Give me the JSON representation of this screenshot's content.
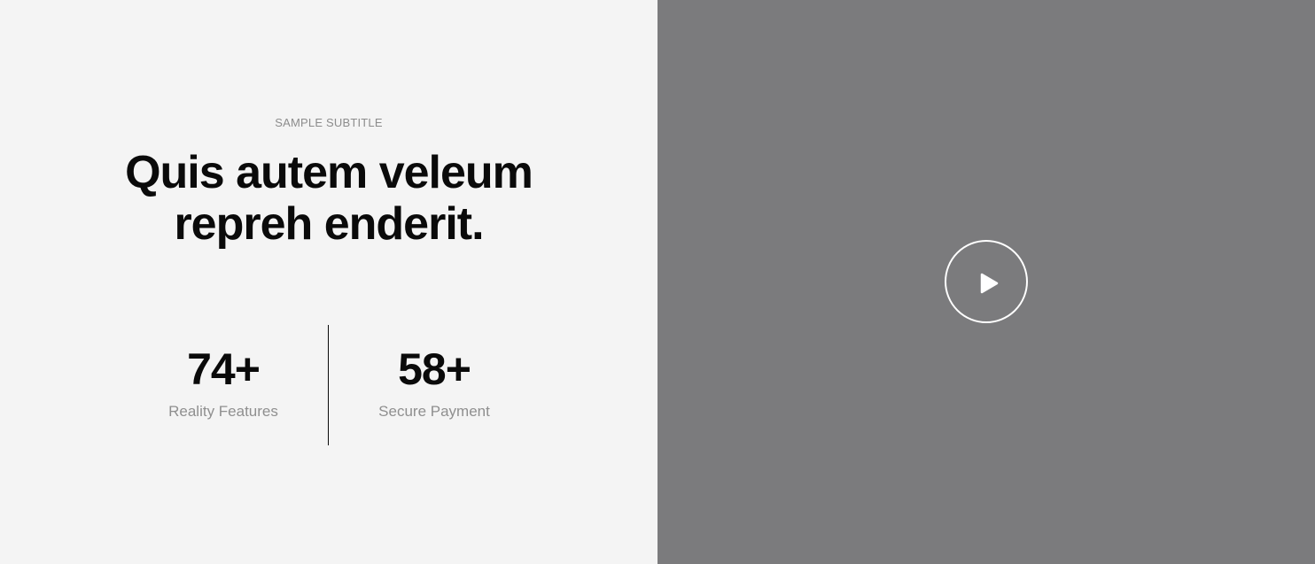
{
  "hero": {
    "subtitle": "SAMPLE SUBTITLE",
    "heading_line1": "Quis autem veleum",
    "heading_line2": "repreh enderit."
  },
  "stats": [
    {
      "value": "74+",
      "label": "Reality Features"
    },
    {
      "value": "58+",
      "label": "Secure Payment"
    }
  ],
  "video": {
    "icon": "play-icon"
  },
  "colors": {
    "left_background": "#f4f4f4",
    "right_background": "#7b7b7d",
    "heading": "#0a0a0a",
    "muted_text": "#8f8f8f",
    "play_button": "#ffffff"
  }
}
